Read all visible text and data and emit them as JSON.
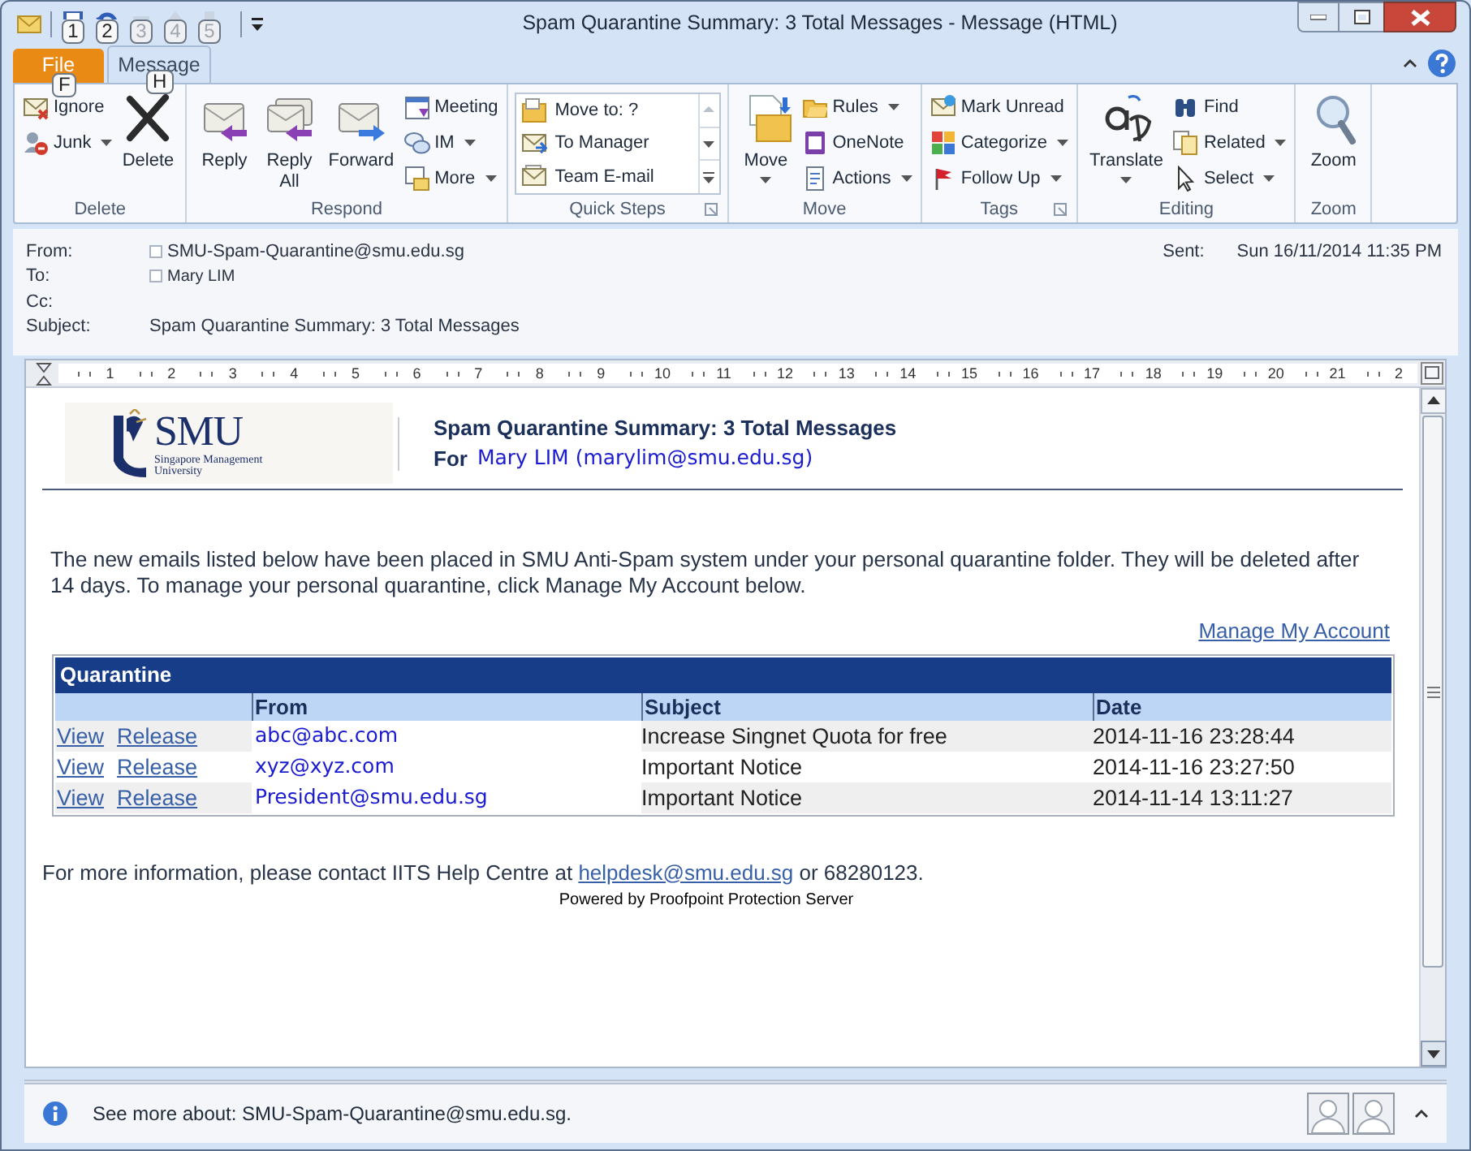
{
  "window": {
    "title": "Spam Quarantine Summary: 3 Total Messages  -  Message (HTML)"
  },
  "quick_access": [
    {
      "keytip": "1",
      "disabled": false
    },
    {
      "keytip": "2",
      "disabled": false
    },
    {
      "keytip": "3",
      "disabled": true
    },
    {
      "keytip": "4",
      "disabled": true
    },
    {
      "keytip": "5",
      "disabled": true
    }
  ],
  "tabs": [
    {
      "label": "File",
      "kind": "file",
      "keytip": "F",
      "selected": false
    },
    {
      "label": "Message",
      "kind": "tab",
      "keytip": "H",
      "selected": true
    }
  ],
  "ribbon": [
    {
      "label": "Delete",
      "launcher": false,
      "items": [
        {
          "kind": "small",
          "label": "Ignore",
          "dropdown": false
        },
        {
          "kind": "small",
          "label": "Junk",
          "dropdown": true
        },
        {
          "kind": "large",
          "label": "Delete",
          "dropdown": false
        }
      ]
    },
    {
      "label": "Respond",
      "launcher": false,
      "items": [
        {
          "kind": "large",
          "label": "Reply",
          "dropdown": false
        },
        {
          "kind": "large",
          "label": "Reply All",
          "dropdown": false
        },
        {
          "kind": "large",
          "label": "Forward",
          "dropdown": false
        },
        {
          "kind": "small",
          "label": "Meeting",
          "dropdown": false
        },
        {
          "kind": "small",
          "label": "IM",
          "dropdown": true
        },
        {
          "kind": "small",
          "label": "More",
          "dropdown": true
        }
      ]
    },
    {
      "label": "Quick Steps",
      "launcher": true,
      "items": [
        {
          "kind": "gallery",
          "entries": [
            "Move to: ?",
            "To Manager",
            "Team E-mail"
          ]
        }
      ]
    },
    {
      "label": "Move",
      "launcher": false,
      "items": [
        {
          "kind": "large",
          "label": "Move",
          "dropdown": true
        },
        {
          "kind": "small",
          "label": "Rules",
          "dropdown": true
        },
        {
          "kind": "small",
          "label": "OneNote",
          "dropdown": false
        },
        {
          "kind": "small",
          "label": "Actions",
          "dropdown": true
        }
      ]
    },
    {
      "label": "Tags",
      "launcher": true,
      "items": [
        {
          "kind": "small",
          "label": "Mark Unread",
          "dropdown": false
        },
        {
          "kind": "small",
          "label": "Categorize",
          "dropdown": true
        },
        {
          "kind": "small",
          "label": "Follow Up",
          "dropdown": true
        }
      ]
    },
    {
      "label": "Editing",
      "launcher": false,
      "items": [
        {
          "kind": "large",
          "label": "Translate",
          "dropdown": true
        },
        {
          "kind": "small",
          "label": "Find",
          "dropdown": false
        },
        {
          "kind": "small",
          "label": "Related",
          "dropdown": true
        },
        {
          "kind": "small",
          "label": "Select",
          "dropdown": true
        }
      ]
    },
    {
      "label": "Zoom",
      "launcher": false,
      "items": [
        {
          "kind": "large",
          "label": "Zoom",
          "dropdown": false
        }
      ]
    }
  ],
  "header": {
    "fields": [
      {
        "label": "From:",
        "value": "SMU-Spam-Quarantine@smu.edu.sg",
        "kind": "contact",
        "checked": false
      },
      {
        "label": "To:",
        "value": "Mary LIM",
        "kind": "contact",
        "checked": false
      },
      {
        "label": "Cc:",
        "kind": "empty"
      },
      {
        "label": "Subject:",
        "value": "Spam Quarantine Summary: 3 Total Messages",
        "kind": "text"
      }
    ],
    "sent": {
      "label": "Sent:",
      "value": "Sun 16/11/2014 11:35 PM"
    }
  },
  "ruler": [
    "1",
    "2",
    "3",
    "4",
    "5",
    "6",
    "7",
    "8",
    "9",
    "10",
    "11",
    "12",
    "13",
    "14",
    "15",
    "16",
    "17",
    "18",
    "19",
    "20",
    "21",
    "2"
  ],
  "email": {
    "logo": {
      "name": "SMU",
      "line_1": "Singapore Management",
      "line_2": "University"
    },
    "title": "Spam Quarantine Summary: 3 Total Messages",
    "for_label": "For",
    "recipient": "Mary LIM (marylim@smu.edu.sg)",
    "intro": "The new emails listed below have been placed in SMU Anti-Spam system under your personal quarantine folder. They will be deleted after 14 days. To manage your personal quarantine, click Manage My Account below.",
    "manage_link": "Manage My Account",
    "table": {
      "caption": "Quarantine",
      "columns": [
        "From",
        "Subject",
        "Date"
      ],
      "rows": [
        {
          "actions": [
            "View",
            "Release"
          ],
          "from": "abc@abc.com",
          "subject": "Increase Singnet Quota for free",
          "date": "2014-11-16 23:28:44"
        },
        {
          "actions": [
            "View",
            "Release"
          ],
          "from": "xyz@xyz.com",
          "subject": "Important Notice",
          "date": "2014-11-16 23:27:50"
        },
        {
          "actions": [
            "View",
            "Release"
          ],
          "from": "President@smu.edu.sg",
          "subject": "Important Notice",
          "date": "2014-11-14 13:11:27"
        }
      ]
    },
    "footer": {
      "before": "For more information, please contact IITS Help Centre at ",
      "link": "helpdesk@smu.edu.sg",
      "after": " or 68280123."
    },
    "powered": "Powered by Proofpoint Protection Server"
  },
  "people_pane": {
    "text": "See more about: SMU-Spam-Quarantine@smu.edu.sg."
  }
}
